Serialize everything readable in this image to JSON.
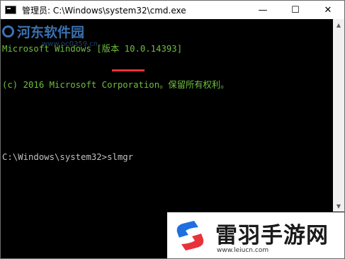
{
  "window": {
    "title": "管理员: C:\\Windows\\system32\\cmd.exe",
    "icon": "cmd-icon",
    "controls": {
      "minimize": "—",
      "maximize": "☐",
      "close": "✕"
    }
  },
  "console": {
    "lines": [
      "Microsoft Windows [版本 10.0.14393]",
      "(c) 2016 Microsoft Corporation。保留所有权利。",
      "",
      "C:\\Windows\\system32>slmgr"
    ],
    "text_color": "#c0c0c0",
    "banner_color": "#6fbf3e",
    "highlight_color": "#e8323a"
  },
  "watermarks": {
    "top_name": "河东软件园",
    "top_url": "www.pc0359.cn",
    "badge_name": "雷羽手游网",
    "badge_url": "www.leiucn.com"
  }
}
